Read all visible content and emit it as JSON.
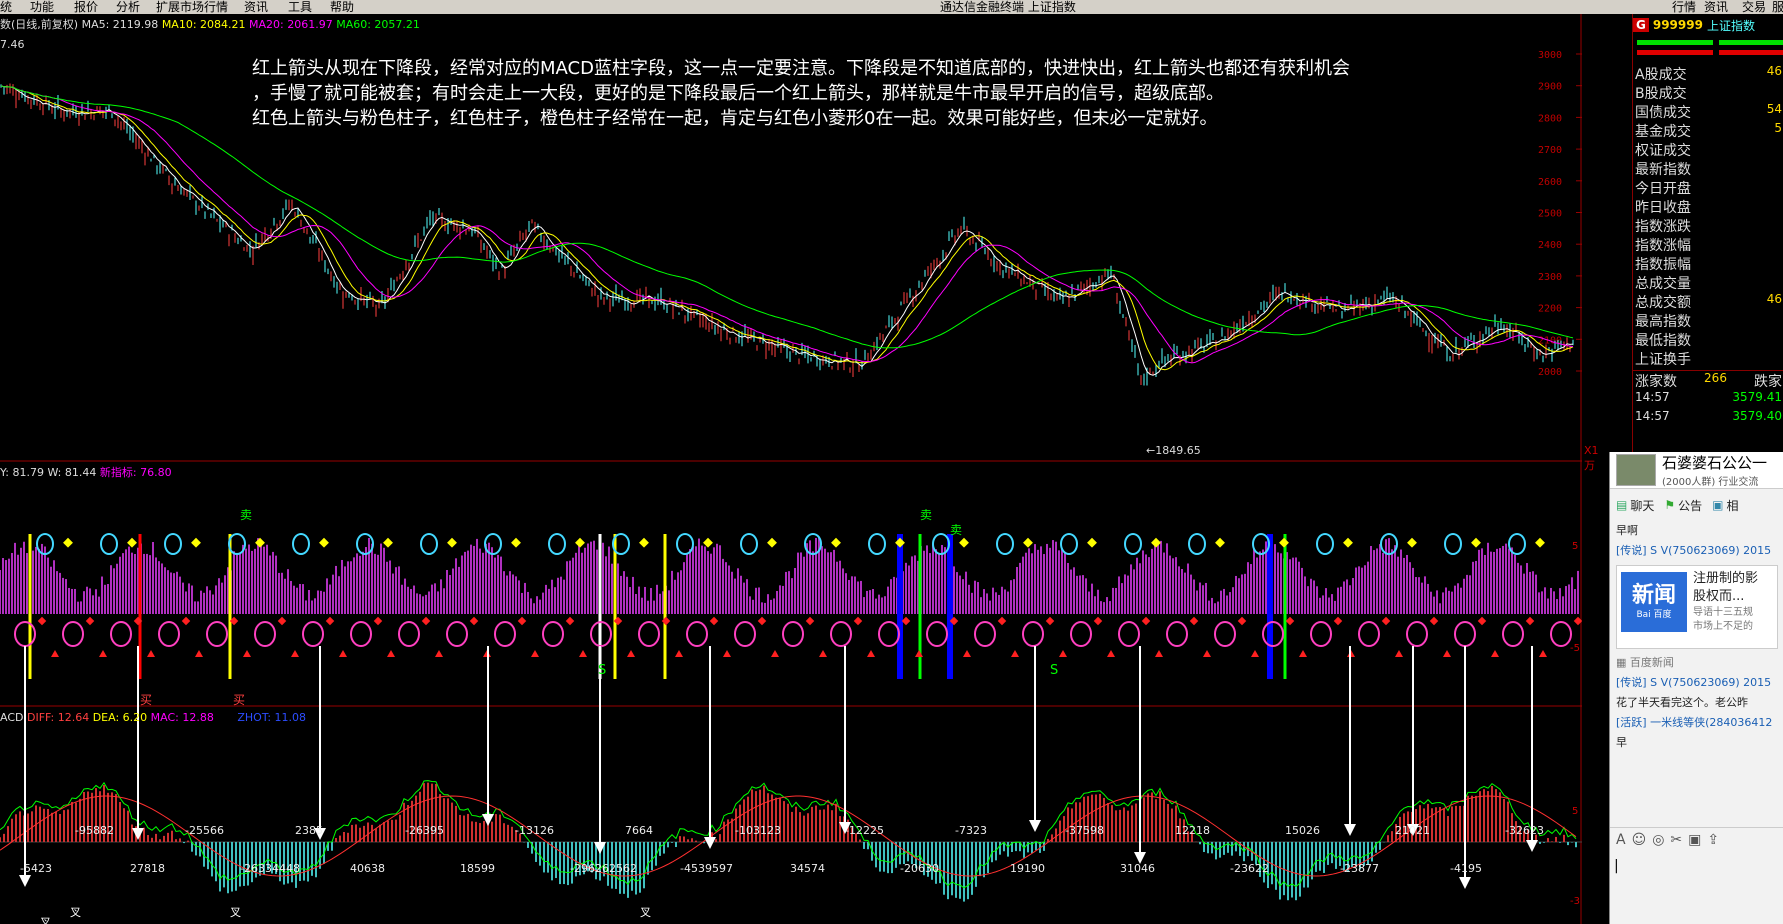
{
  "menubar": {
    "items": [
      "统",
      "功能",
      "报价",
      "分析",
      "扩展市场行情",
      "资讯",
      "工具",
      "帮助"
    ],
    "center": "通达信金融终端  上证指数",
    "right_items": [
      "行情",
      "资讯",
      "交易",
      "服"
    ]
  },
  "main_chart": {
    "legend_text": "数(日线,前复权)",
    "ma5": "MA5: 2119.98",
    "ma10": "MA10: 2084.21",
    "ma20": "MA20: 2061.97",
    "ma60": "MA60: 2057.21",
    "left_value": "7.46",
    "low_mark": "1849.65",
    "price_axis": [
      "3000",
      "2900",
      "2800",
      "2700",
      "2600",
      "2500",
      "2400",
      "2300",
      "2200",
      "2100",
      "2000"
    ],
    "colors": {
      "ma5": "#ffffff",
      "ma10": "#ffff00",
      "ma20": "#ff00ff",
      "ma60": "#00ff00",
      "up": "#ff4040",
      "down": "#54ffff"
    }
  },
  "annotation": {
    "line1": "红上箭头从现在下降段，经常对应的MACD蓝柱字段，这一点一定要注意。下降段是不知道底部的，快进快出，红上箭头也都还有获利机会",
    "line2": "，手慢了就可能被套；有时会走上一大段，更好的是下降段最后一个红上箭头，那样就是牛市最早开启的信号，超级底部。",
    "line3": "红色上箭头与粉色柱子，红色柱子，橙色柱子经常在一起，肯定与红色小菱形0在一起。效果可能好些，但未必一定就好。"
  },
  "indicator2": {
    "legend_y": "Y: 81.79",
    "legend_w": "W: 81.44",
    "legend_x": "新指标: 76.80",
    "right_axis": "X1万",
    "labels_buy": "买",
    "labels_sell": "卖",
    "labels_s": "S",
    "right_ticks": [
      "5",
      "-5"
    ]
  },
  "macd": {
    "name": "ACD",
    "diff": "DIFF: 12.64",
    "dea": "DEA: 6.20",
    "mac": "MAC: 12.88",
    "zhot": "ZHOT: 11.08",
    "values": [
      "-5423",
      "-95882",
      "27818",
      "-25566",
      "-26334448",
      "2385",
      "40638",
      "-26395",
      "18599",
      "-13126",
      "-296262562",
      "7664",
      "-4539597",
      "-103123",
      "34574",
      "-12225",
      "-20630",
      "-7323",
      "19190",
      "-37598",
      "31046",
      "12218",
      "-23622",
      "15026",
      "-23877",
      "21021",
      "-4195",
      "-32623"
    ],
    "right_ticks": [
      "5",
      "-3"
    ],
    "labels_cha": "叉"
  },
  "right_panel": {
    "badge": "G",
    "code": "999999",
    "name": "上证指数",
    "rows": [
      {
        "label": "A股成交",
        "value": "46"
      },
      {
        "label": "B股成交",
        "value": ""
      },
      {
        "label": "国债成交",
        "value": "54"
      },
      {
        "label": "基金成交",
        "value": "5"
      },
      {
        "label": "权证成交",
        "value": ""
      },
      {
        "label": "最新指数",
        "value": ""
      },
      {
        "label": "今日开盘",
        "value": ""
      },
      {
        "label": "昨日收盘",
        "value": ""
      },
      {
        "label": "指数涨跌",
        "value": ""
      },
      {
        "label": "指数涨幅",
        "value": ""
      },
      {
        "label": "指数振幅",
        "value": ""
      },
      {
        "label": "总成交量",
        "value": ""
      },
      {
        "label": "总成交额",
        "value": "46"
      },
      {
        "label": "最高指数",
        "value": ""
      },
      {
        "label": "最低指数",
        "value": ""
      },
      {
        "label": "上证换手",
        "value": ""
      }
    ],
    "up_count_label": "涨家数",
    "up_count": "266",
    "down_count_label": "跌家",
    "ticks": [
      {
        "time": "14:57",
        "price": "3579.41"
      },
      {
        "time": "14:57",
        "price": "3579.40"
      }
    ]
  },
  "chat": {
    "group_name": "石婆婆石公公一",
    "group_meta": "(2000人群) 行业交流",
    "tabs": [
      "聊天",
      "公告",
      "相"
    ],
    "messages": [
      {
        "text": "早啊"
      },
      {
        "tag": "[传说]",
        "user": "S V(750623069) 2015"
      },
      {
        "news_title": "注册制的影",
        "news_sub": "股权而...",
        "news_extra": "导语十三五规",
        "news_extra2": "市场上不足的"
      },
      {
        "source": "百度新闻"
      },
      {
        "tag": "[传说]",
        "user": "S V(750623069) 2015"
      },
      {
        "text": "花了半天看完这个。老公昨"
      },
      {
        "tag": "[活跃]",
        "user": "一米线等侠(284036412"
      },
      {
        "text": "早"
      }
    ],
    "news_logo": "新闻",
    "news_logo_sub": "Bai 百度"
  }
}
